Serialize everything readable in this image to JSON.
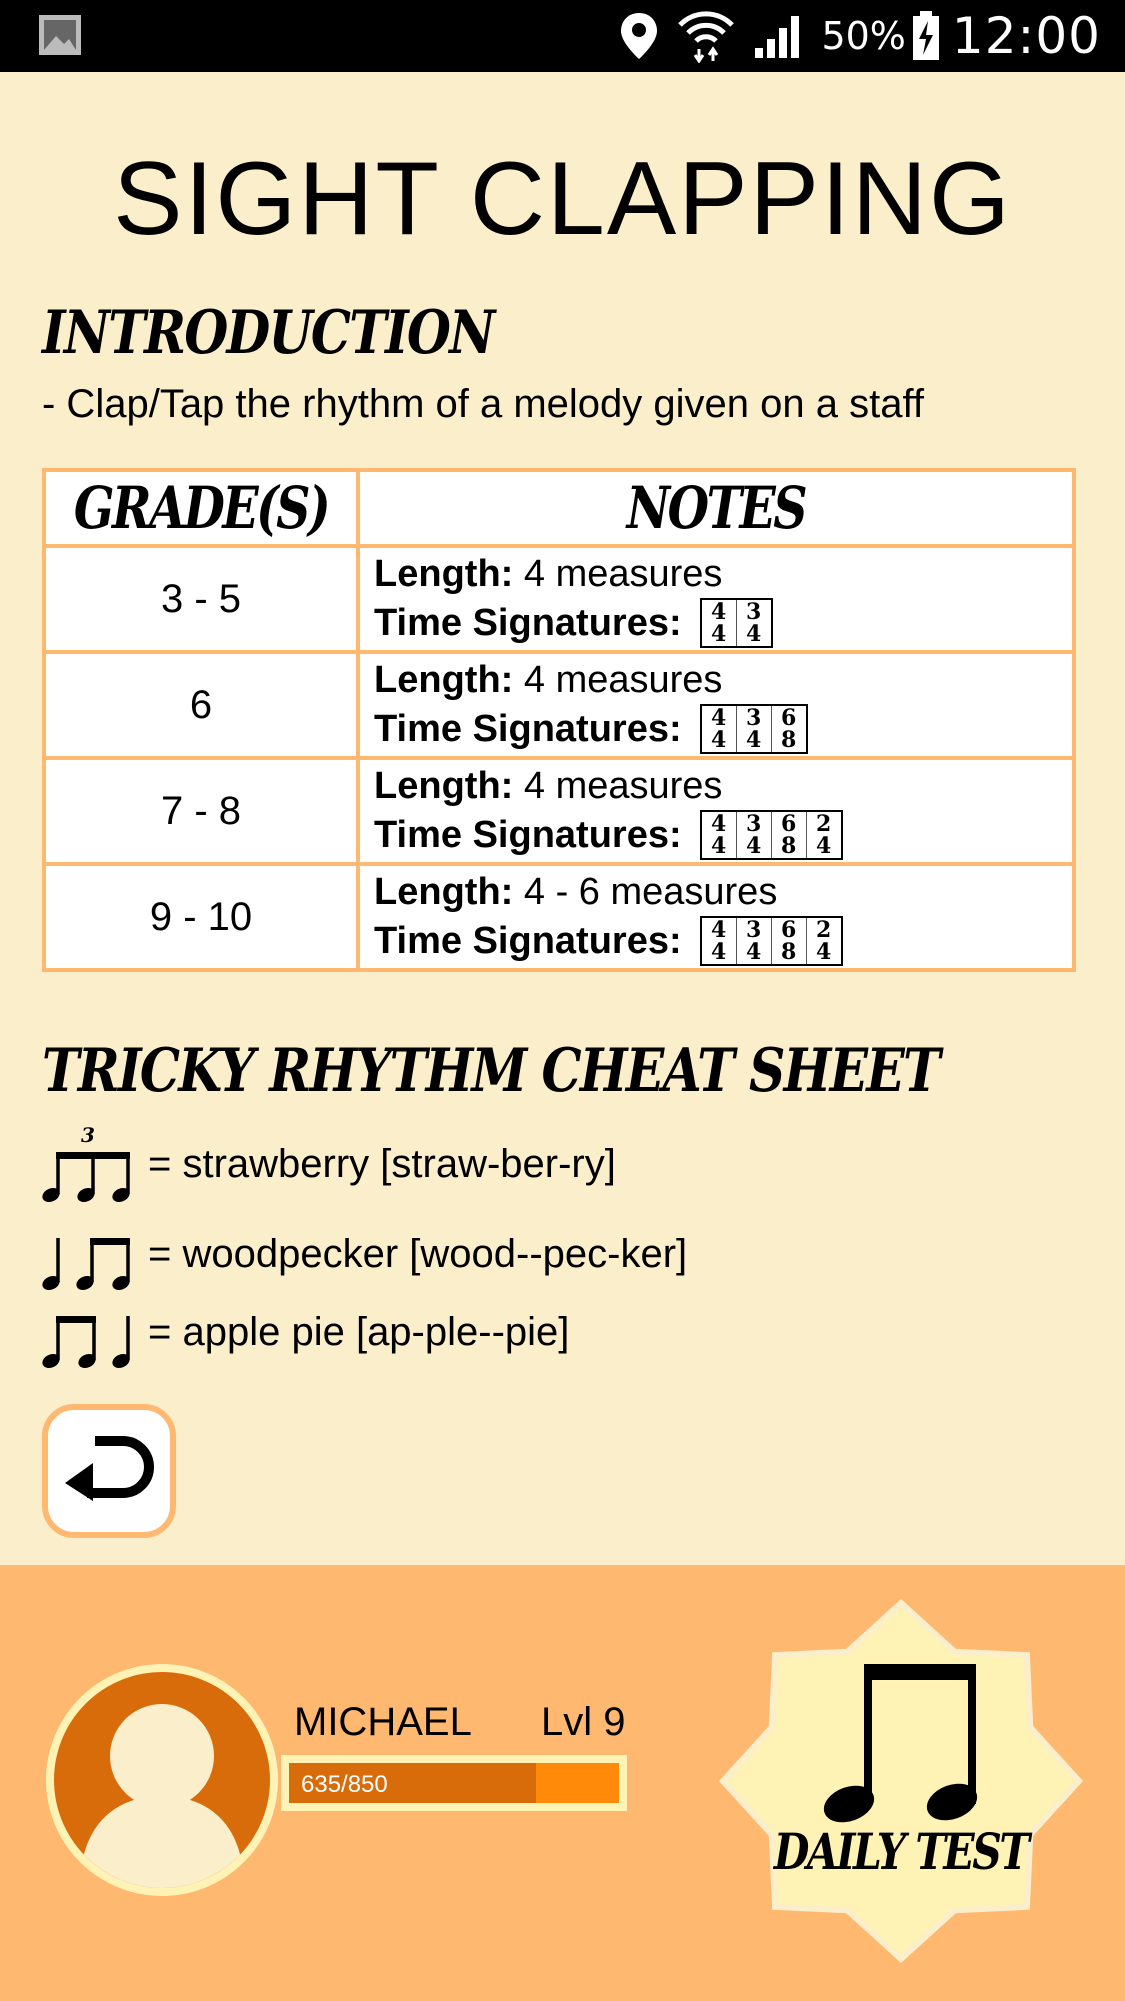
{
  "status_bar": {
    "icons": [
      "gallery-icon",
      "location-icon",
      "wifi-icon",
      "signal-icon",
      "battery-icon"
    ],
    "battery_percent": "50%",
    "time": "12:00"
  },
  "title": "SIGHT CLAPPING",
  "introduction": {
    "heading": "INTRODUCTION",
    "text": "- Clap/Tap the rhythm of a melody given on a staff"
  },
  "grades_table": {
    "headers": {
      "grade": "GRADE(S)",
      "notes": "NOTES"
    },
    "length_label": "Length:",
    "time_sig_label": "Time Signatures:",
    "rows": [
      {
        "grade": "3 - 5",
        "length": "4 measures",
        "time_signatures": [
          [
            "4",
            "4"
          ],
          [
            "3",
            "4"
          ]
        ]
      },
      {
        "grade": "6",
        "length": "4 measures",
        "time_signatures": [
          [
            "4",
            "4"
          ],
          [
            "3",
            "4"
          ],
          [
            "6",
            "8"
          ]
        ]
      },
      {
        "grade": "7 - 8",
        "length": "4 measures",
        "time_signatures": [
          [
            "4",
            "4"
          ],
          [
            "3",
            "4"
          ],
          [
            "6",
            "8"
          ],
          [
            "2",
            "4"
          ]
        ]
      },
      {
        "grade": "9 - 10",
        "length": "4 - 6 measures",
        "time_signatures": [
          [
            "4",
            "4"
          ],
          [
            "3",
            "4"
          ],
          [
            "6",
            "8"
          ],
          [
            "2",
            "4"
          ]
        ]
      }
    ]
  },
  "cheat_sheet": {
    "heading": "TRICKY RHYTHM CHEAT SHEET",
    "items": [
      {
        "icon": "triplet-eighths-icon",
        "triplet_number": "3",
        "text": "= strawberry [straw-ber-ry]"
      },
      {
        "icon": "quarter-two-eighths-icon",
        "text": "= woodpecker [wood--pec-ker]"
      },
      {
        "icon": "two-eighths-quarter-icon",
        "text": "= apple pie [ap-ple--pie]"
      }
    ]
  },
  "back_button": {
    "icon": "back-arrow-icon"
  },
  "user": {
    "name": "MICHAEL",
    "level": "Lvl 9",
    "xp_text": "635/850",
    "xp_fraction": 0.747
  },
  "daily_test": {
    "label": "DAILY TEST",
    "icon": "beamed-eighth-notes-icon"
  },
  "colors": {
    "background": "#fbeecb",
    "accent": "#ffb870",
    "avatar": "#d86c0a",
    "xp_bar": "#ff8a0a",
    "badge": "#fff2b5"
  }
}
